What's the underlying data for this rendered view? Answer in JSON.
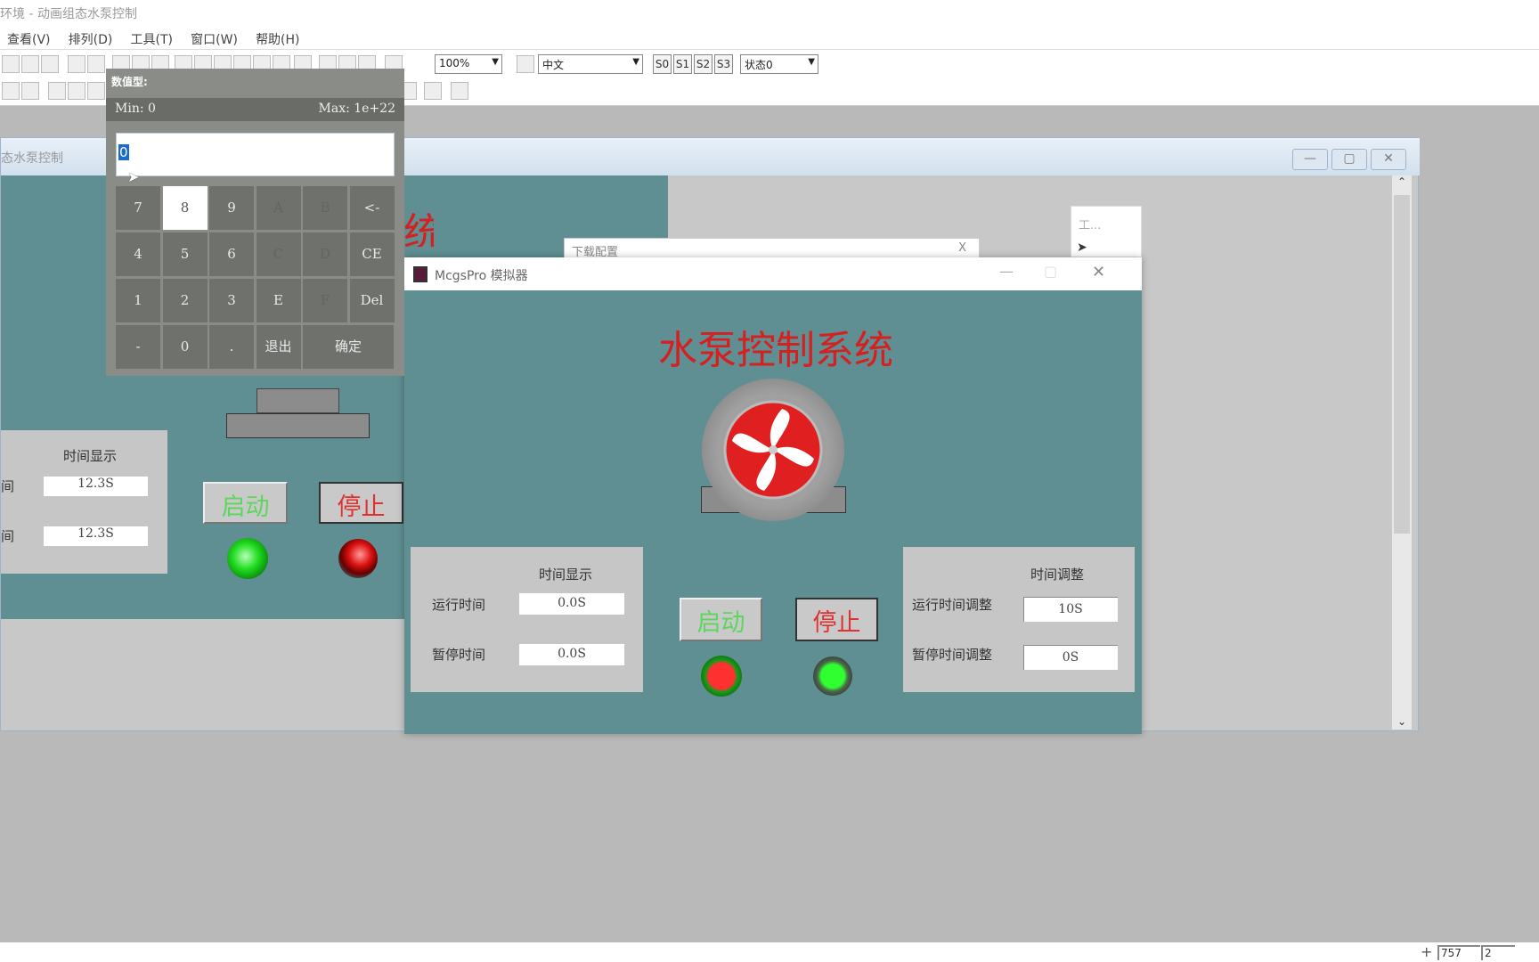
{
  "window_title": "环境 - 动画组态水泵控制",
  "menu": [
    "查看(V)",
    "排列(D)",
    "工具(T)",
    "窗口(W)",
    "帮助(H)"
  ],
  "toolbar": {
    "zoom": "100%",
    "language": "中文",
    "states": [
      "S0",
      "S1",
      "S2",
      "S3"
    ],
    "state_select": "状态0"
  },
  "editor": {
    "title": "态水泵控制",
    "title_partial_char": "统",
    "panel_title": "时间显示",
    "run_label": "间",
    "pause_label": "间",
    "run_value": "12.3S",
    "pause_value": "12.3S",
    "start": "启动",
    "stop": "停止"
  },
  "keypad": {
    "title": "数值型:",
    "min": "Min: 0",
    "max": "Max: 1e+22",
    "value": "0",
    "keys": [
      "7",
      "8",
      "9",
      "A",
      "B",
      "<-",
      "4",
      "5",
      "6",
      "C",
      "D",
      "CE",
      "1",
      "2",
      "3",
      "E",
      "F",
      "Del",
      "-",
      "0",
      ".",
      "退出",
      "确定"
    ]
  },
  "download_dialog": {
    "title": "下载配置",
    "close": "X"
  },
  "toolbox": {
    "title": "工..."
  },
  "simulator": {
    "title": "McgsPro 模拟器",
    "heading": "水泵控制系统",
    "display_panel": {
      "title": "时间显示",
      "run_label": "运行时间",
      "run_value": "0.0S",
      "pause_label": "暂停时间",
      "pause_value": "0.0S"
    },
    "adjust_panel": {
      "title": "时间调整",
      "run_label": "运行时间调整",
      "run_value": "10S",
      "pause_label": "暂停时间调整",
      "pause_value": "0S"
    },
    "start": "启动",
    "stop": "停止"
  },
  "statusbar": {
    "x": "757",
    "y": "2"
  },
  "colors": {
    "teal": "#5f8f92",
    "title_red": "#d42020",
    "start_green": "#5cd65c",
    "stop_red": "#e03030"
  }
}
